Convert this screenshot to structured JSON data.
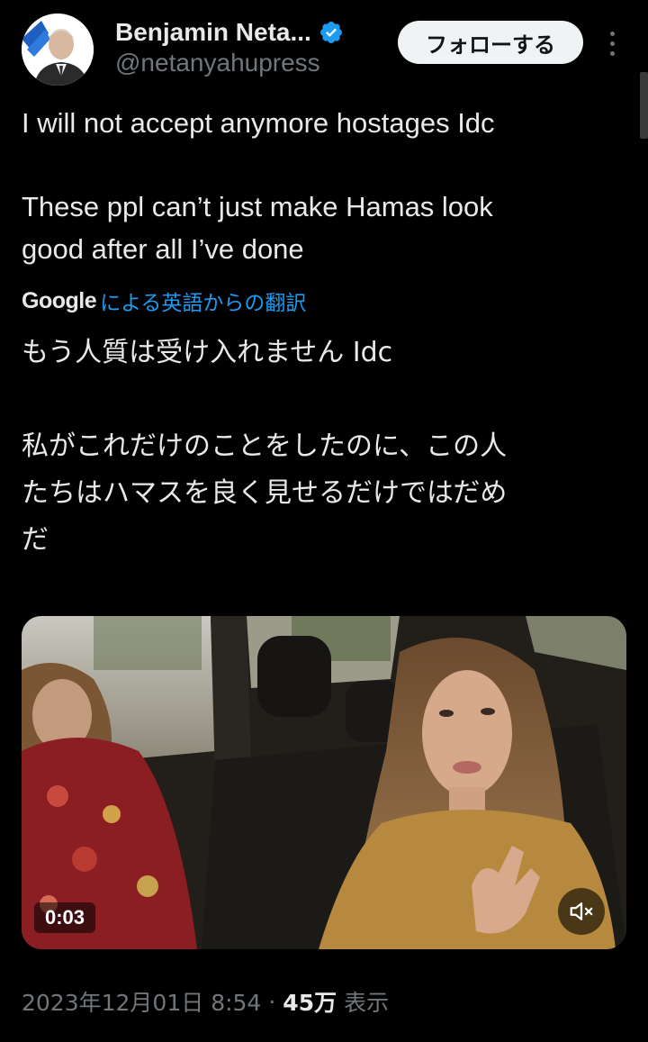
{
  "author": {
    "display_name": "Benjamin Neta...",
    "handle": "@netanyahupress",
    "verified": true,
    "badge_color": "#1d9bf0"
  },
  "actions": {
    "follow_label": "フォローする",
    "more_icon": "more-vertical-icon"
  },
  "tweet": {
    "text_line1": "I will not accept anymore hostages Idc",
    "text_line2": "These ppl can’t just make Hamas look\ngood after all I’ve done"
  },
  "translation": {
    "provider": "Google",
    "link_text": "による英語からの翻訳",
    "text_line1": "もう人質は受け入れません Idc",
    "text_line2": "私がこれだけのことをしたのに、この人\nたちはハマスを良く見せるだけではだめ\nだ"
  },
  "media": {
    "type": "video",
    "duration": "0:03",
    "mute_icon": "volume-muted-icon"
  },
  "meta": {
    "timestamp": "2023年12月01日 8:54",
    "separator": "·",
    "views_count": "45万",
    "views_label": "表示"
  },
  "colors": {
    "background": "#000000",
    "text_primary": "#e7e9ea",
    "text_secondary": "#71767b",
    "link": "#1d9bf0",
    "follow_button_bg": "#eff3f4"
  }
}
